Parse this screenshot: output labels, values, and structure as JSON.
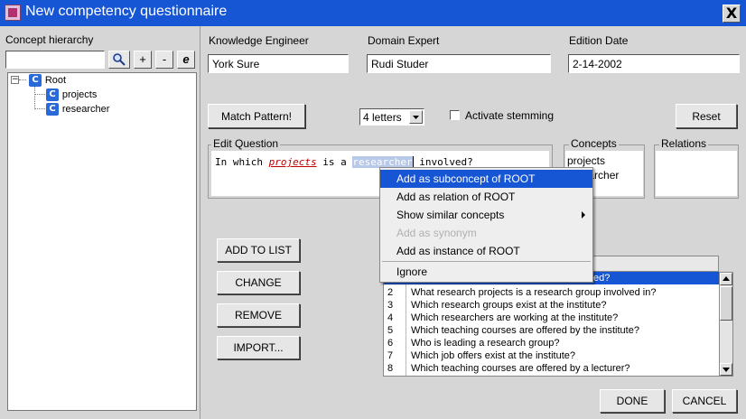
{
  "window": {
    "title": "New competency questionnaire",
    "close_label": "X"
  },
  "left": {
    "concept_hierarchy_label": "Concept hierarchy",
    "search_value": "",
    "plus_label": "+",
    "minus_label": "-",
    "e_label": "e",
    "tree": {
      "root": {
        "icon_letter": "C",
        "label": "Root"
      },
      "children": [
        {
          "icon_letter": "C",
          "label": "projects"
        },
        {
          "icon_letter": "C",
          "label": "researcher"
        }
      ]
    }
  },
  "fields": {
    "knowledge_engineer_label": "Knowledge Engineer",
    "knowledge_engineer_value": "York Sure",
    "domain_expert_label": "Domain Expert",
    "domain_expert_value": "Rudi Studer",
    "edition_date_label": "Edition Date",
    "edition_date_value": "2-14-2002"
  },
  "controls": {
    "match_pattern_label": "Match Pattern!",
    "letters_select_value": "4 letters",
    "activate_stemming_label": "Activate stemming",
    "reset_label": "Reset"
  },
  "edit_question": {
    "label": "Edit Question",
    "part1": "In which ",
    "term1": "projects",
    "part2": " is a ",
    "term2": "researcher",
    "part3": " involved?"
  },
  "concepts": {
    "label": "Concepts",
    "items": [
      "projects",
      "researcher"
    ]
  },
  "relations": {
    "label": "Relations"
  },
  "context_menu": {
    "items": [
      {
        "label": "Add as subconcept of ROOT",
        "state": "selected"
      },
      {
        "label": "Add as relation of ROOT",
        "state": "normal"
      },
      {
        "label": "Show similar concepts",
        "state": "submenu"
      },
      {
        "label": "Add as synonym",
        "state": "disabled"
      },
      {
        "label": "Add as instance of ROOT",
        "state": "normal"
      },
      {
        "label": "Ignore",
        "state": "normal"
      }
    ]
  },
  "buttons": {
    "add_to_list": "ADD TO LIST",
    "change": "CHANGE",
    "remove": "REMOVE",
    "import": "IMPORT...",
    "done": "DONE",
    "cancel": "CANCEL"
  },
  "questions": {
    "rows": [
      {
        "num": "",
        "text": "ed?",
        "selected": true
      },
      {
        "num": "2",
        "text": "What research projects is a research group involved in?"
      },
      {
        "num": "3",
        "text": "Which research groups exist at the institute?"
      },
      {
        "num": "4",
        "text": "Which researchers are working at the institute?"
      },
      {
        "num": "5",
        "text": "Which teaching courses are offered by the institute?"
      },
      {
        "num": "6",
        "text": "Who is leading a research group?"
      },
      {
        "num": "7",
        "text": "Which job offers exist at the institute?"
      },
      {
        "num": "8",
        "text": "Which teaching courses are offered by a lecturer?"
      }
    ]
  },
  "colors": {
    "title_bar": "#1655d4",
    "selection": "#1655d4",
    "term_red": "#c00000",
    "background": "#d6d6d6"
  }
}
